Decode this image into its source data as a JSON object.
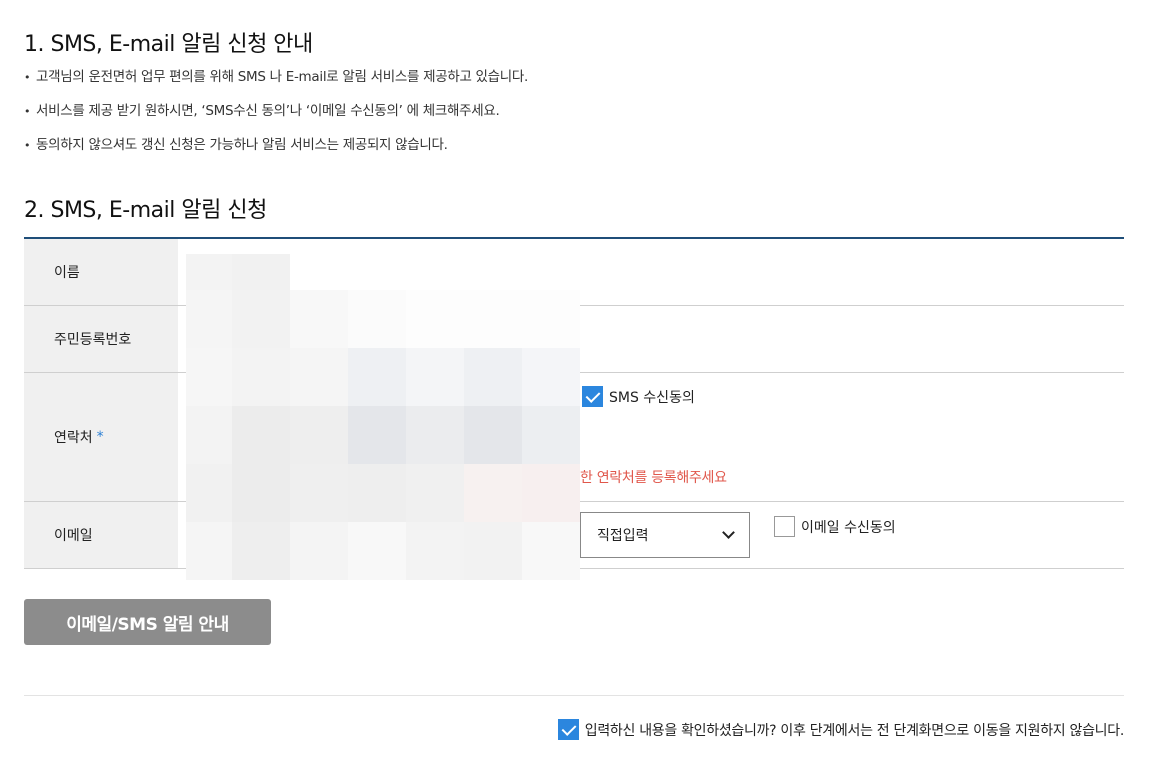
{
  "section1": {
    "title": "1. SMS, E-mail 알림 신청 안내",
    "notices": [
      "고객님의 운전면허 업무 편의를 위해 SMS 나 E-mail로 알림 서비스를 제공하고 있습니다.",
      "서비스를 제공 받기 원하시면, ‘SMS수신 동의’나 ‘이메일 수신동의’ 에 체크해주세요.",
      "동의하지 않으셔도 갱신 신청은 가능하나 알림 서비스는 제공되지 않습니다."
    ]
  },
  "section2": {
    "title": "2. SMS, E-mail 알림 신청",
    "rows": {
      "name_label": "이름",
      "rrn_label": "주민등록번호",
      "contact_label": "연락처",
      "required_mark": "*",
      "email_label": "이메일"
    },
    "sms_consent": {
      "label": "SMS 수신동의",
      "checked": true
    },
    "contact_warning": "한 연락처를 등록해주세요",
    "email_domain_select": {
      "selected": "직접입력"
    },
    "email_consent": {
      "label": "이메일 수신동의",
      "checked": false
    }
  },
  "info_button_label": "이메일/SMS 알림 안내",
  "final_confirm": {
    "label": "입력하신 내용을 확인하셨습니까? 이후 단계에서는 전 단계화면으로 이동을 지원하지 않습니다.",
    "checked": true
  },
  "colors": {
    "accent_blue": "#2b86de",
    "table_top_border": "#1f4e79",
    "warning_red": "#e0574b",
    "button_gray": "#8c8c8c"
  },
  "icons": [
    "checkbox-checked-icon",
    "checkbox-unchecked-icon",
    "chevron-down-icon"
  ]
}
